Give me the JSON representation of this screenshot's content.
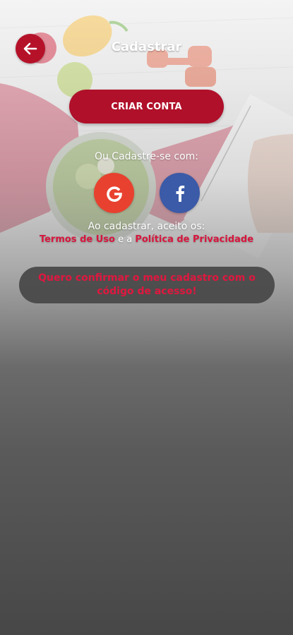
{
  "header": {
    "title": "Cadastrar",
    "back_icon": "arrow-left-icon"
  },
  "actions": {
    "create_account_label": "CRIAR CONTA"
  },
  "social": {
    "prompt": "Ou Cadastre-se com:",
    "google_icon": "google-icon",
    "facebook_icon": "facebook-icon"
  },
  "terms": {
    "intro": "Ao cadastrar, aceito os:",
    "terms_link": "Termos de Uso",
    "connector": "e a",
    "privacy_link": "Política de Privacidade"
  },
  "confirm": {
    "label": "Quero confirmar o meu cadastro com o código de acesso!"
  },
  "colors": {
    "brand_red": "#b0102a",
    "link_red": "#d7163d",
    "google": "#e8412f",
    "facebook": "#3b5aa8"
  }
}
